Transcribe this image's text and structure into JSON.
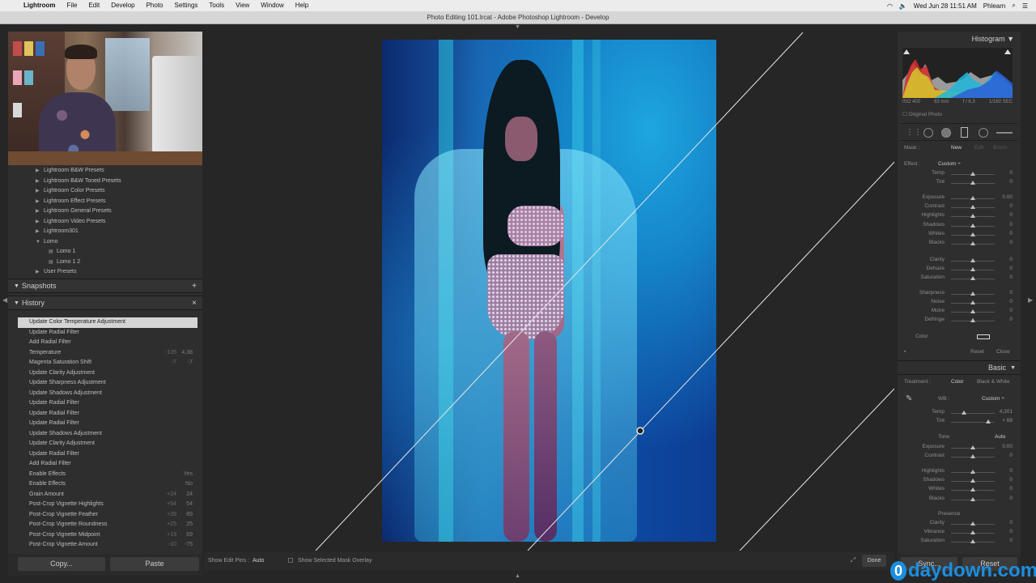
{
  "menubar": {
    "app_name": "Lightroom",
    "items": [
      "File",
      "Edit",
      "Develop",
      "Photo",
      "Settings",
      "Tools",
      "View",
      "Window",
      "Help"
    ],
    "datetime": "Wed Jun 28  11:51 AM",
    "user": "Phlearn"
  },
  "window": {
    "title": "Photo Editing 101.lrcat - Adobe Photoshop Lightroom - Develop"
  },
  "presets": {
    "items": [
      {
        "label": "Lightroom B&W Presets",
        "level": 1,
        "tri": "▶"
      },
      {
        "label": "Lightroom B&W Toned Presets",
        "level": 1,
        "tri": "▶"
      },
      {
        "label": "Lightroom Color Presets",
        "level": 1,
        "tri": "▶"
      },
      {
        "label": "Lightroom Effect Presets",
        "level": 1,
        "tri": "▶"
      },
      {
        "label": "Lightroom General Presets",
        "level": 1,
        "tri": "▶"
      },
      {
        "label": "Lightroom Video Presets",
        "level": 1,
        "tri": "▶"
      },
      {
        "label": "Lightroom301",
        "level": 1,
        "tri": "▶"
      },
      {
        "label": "Lomo",
        "level": 1,
        "tri": "▼"
      },
      {
        "label": "Lomo 1",
        "level": 2,
        "tri": "▤"
      },
      {
        "label": "Lomo 1 2",
        "level": 2,
        "tri": "▤"
      },
      {
        "label": "User Presets",
        "level": 1,
        "tri": "▶"
      }
    ]
  },
  "snapshots": {
    "title": "Snapshots",
    "action": "+"
  },
  "history": {
    "title": "History",
    "action": "×",
    "items": [
      {
        "label": "Update Color Temperature Adjustment",
        "v1": "",
        "v2": "",
        "selected": true
      },
      {
        "label": "Update Radial Filter",
        "v1": "",
        "v2": ""
      },
      {
        "label": "Add Radial Filter",
        "v1": "",
        "v2": ""
      },
      {
        "label": "Temperature",
        "v1": "-135",
        "v2": "4,38"
      },
      {
        "label": "Magenta Saturation Shift",
        "v1": "-7",
        "v2": "-7"
      },
      {
        "label": "Update Clarity Adjustment",
        "v1": "",
        "v2": ""
      },
      {
        "label": "Update Sharpness Adjustment",
        "v1": "",
        "v2": ""
      },
      {
        "label": "Update Shadows Adjustment",
        "v1": "",
        "v2": ""
      },
      {
        "label": "Update Radial Filter",
        "v1": "",
        "v2": ""
      },
      {
        "label": "Update Radial Filter",
        "v1": "",
        "v2": ""
      },
      {
        "label": "Update Radial Filter",
        "v1": "",
        "v2": ""
      },
      {
        "label": "Update Shadows Adjustment",
        "v1": "",
        "v2": ""
      },
      {
        "label": "Update Clarity Adjustment",
        "v1": "",
        "v2": ""
      },
      {
        "label": "Update Radial Filter",
        "v1": "",
        "v2": ""
      },
      {
        "label": "Add Radial Filter",
        "v1": "",
        "v2": ""
      },
      {
        "label": "Enable Effects",
        "v1": "",
        "v2": "Yes"
      },
      {
        "label": "Enable Effects",
        "v1": "",
        "v2": "No"
      },
      {
        "label": "Grain Amount",
        "v1": "+24",
        "v2": "24"
      },
      {
        "label": "Post-Crop Vignette Highlights",
        "v1": "+54",
        "v2": "54"
      },
      {
        "label": "Post-Crop Vignette Feather",
        "v1": "+39",
        "v2": "89"
      },
      {
        "label": "Post-Crop Vignette Roundness",
        "v1": "+25",
        "v2": "25"
      },
      {
        "label": "Post-Crop Vignette Midpoint",
        "v1": "+19",
        "v2": "69"
      },
      {
        "label": "Post-Crop Vignette Amount",
        "v1": "-10",
        "v2": "-75"
      },
      {
        "label": "Post-Crop Vignette Amount",
        "v1": "-65",
        "v2": "-65"
      }
    ]
  },
  "left_buttons": {
    "copy": "Copy...",
    "paste": "Paste"
  },
  "center_toolbar": {
    "show_edit_pins_label": "Show Edit Pins :",
    "show_edit_pins_value": "Auto",
    "mask_overlay_label": "Show Selected Mask Overlay",
    "done_label": "Done"
  },
  "right_panel": {
    "histogram_title": "Histogram",
    "meta": [
      "ISO 400",
      "63 mm",
      "f / 6.3",
      "1/160 SEC"
    ],
    "original_photo": "Original Photo",
    "mask": {
      "label": "Mask :",
      "new": "New",
      "edit": "Edit",
      "brush": "Brush"
    },
    "effect": {
      "label": "Effect :",
      "value": "Custom ÷"
    },
    "effect_sliders": [
      {
        "label": "Temp",
        "value": "0",
        "pos": 0.5
      },
      {
        "label": "Tint",
        "value": "0",
        "pos": 0.5
      },
      {
        "label": "Exposure",
        "value": "0.00",
        "pos": 0.5
      },
      {
        "label": "Contrast",
        "value": "0",
        "pos": 0.5
      },
      {
        "label": "Highlights",
        "value": "0",
        "pos": 0.5
      },
      {
        "label": "Shadows",
        "value": "0",
        "pos": 0.5
      },
      {
        "label": "Whites",
        "value": "0",
        "pos": 0.5
      },
      {
        "label": "Blacks",
        "value": "0",
        "pos": 0.5
      },
      {
        "label": "Clarity",
        "value": "0",
        "pos": 0.5
      },
      {
        "label": "Dehaze",
        "value": "0",
        "pos": 0.5
      },
      {
        "label": "Saturation",
        "value": "0",
        "pos": 0.5
      },
      {
        "label": "Sharpness",
        "value": "0",
        "pos": 0.5
      },
      {
        "label": "Noise",
        "value": "0",
        "pos": 0.5
      },
      {
        "label": "Moire",
        "value": "0",
        "pos": 0.5
      },
      {
        "label": "Defringe",
        "value": "0",
        "pos": 0.5
      }
    ],
    "color_label": "Color",
    "reset": "Reset",
    "close": "Close",
    "basic": {
      "title": "Basic",
      "treatment_label": "Treatment :",
      "color": "Color",
      "bw": "Black & White",
      "wb_label": "WB :",
      "wb_value": "Custom ÷",
      "temp": {
        "label": "Temp",
        "value": "4,301",
        "pos": 0.3
      },
      "tint": {
        "label": "Tint",
        "value": "+ 88",
        "pos": 0.85
      },
      "tone_label": "Tone",
      "auto": "Auto",
      "tone_sliders": [
        {
          "label": "Exposure",
          "value": "0.00",
          "pos": 0.5
        },
        {
          "label": "Contrast",
          "value": "0",
          "pos": 0.5
        },
        {
          "label": "Highlights",
          "value": "0",
          "pos": 0.5
        },
        {
          "label": "Shadows",
          "value": "0",
          "pos": 0.5
        },
        {
          "label": "Whites",
          "value": "0",
          "pos": 0.5
        },
        {
          "label": "Blacks",
          "value": "0",
          "pos": 0.5
        }
      ],
      "presence_label": "Presence",
      "presence_sliders": [
        {
          "label": "Clarity",
          "value": "0",
          "pos": 0.5
        },
        {
          "label": "Vibrance",
          "value": "0",
          "pos": 0.5
        },
        {
          "label": "Saturation",
          "value": "0",
          "pos": 0.5
        }
      ]
    },
    "sync": "Sync...",
    "reset_all": "Reset"
  },
  "watermark": {
    "glyph": "0",
    "domain": "daydown.com"
  }
}
